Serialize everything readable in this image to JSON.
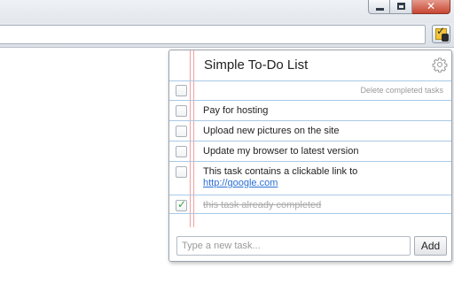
{
  "window": {
    "controls": {
      "minimize_icon": "minimize-icon",
      "maximize_icon": "maximize-icon",
      "close_label": "✕"
    }
  },
  "extension": {
    "icon": "todo-extension-icon"
  },
  "popup": {
    "title": "Simple To-Do List",
    "settings_icon": "gear-icon",
    "delete_completed_label": "Delete completed tasks",
    "tasks": [
      {
        "text": "Pay for hosting",
        "completed": false
      },
      {
        "text": "Upload new pictures on the site",
        "completed": false
      },
      {
        "text": "Update my browser to latest version",
        "completed": false
      },
      {
        "text": "This task contains a clickable link to",
        "link": "http://google.com",
        "completed": false
      },
      {
        "text": "this task already completed",
        "completed": true
      }
    ],
    "new_task_placeholder": "Type a new task...",
    "add_button_label": "Add"
  },
  "colors": {
    "rule_line": "#a9c9e6",
    "margin_line": "#f2a0a0",
    "link": "#2a6fd6",
    "check": "#3aa33a"
  }
}
